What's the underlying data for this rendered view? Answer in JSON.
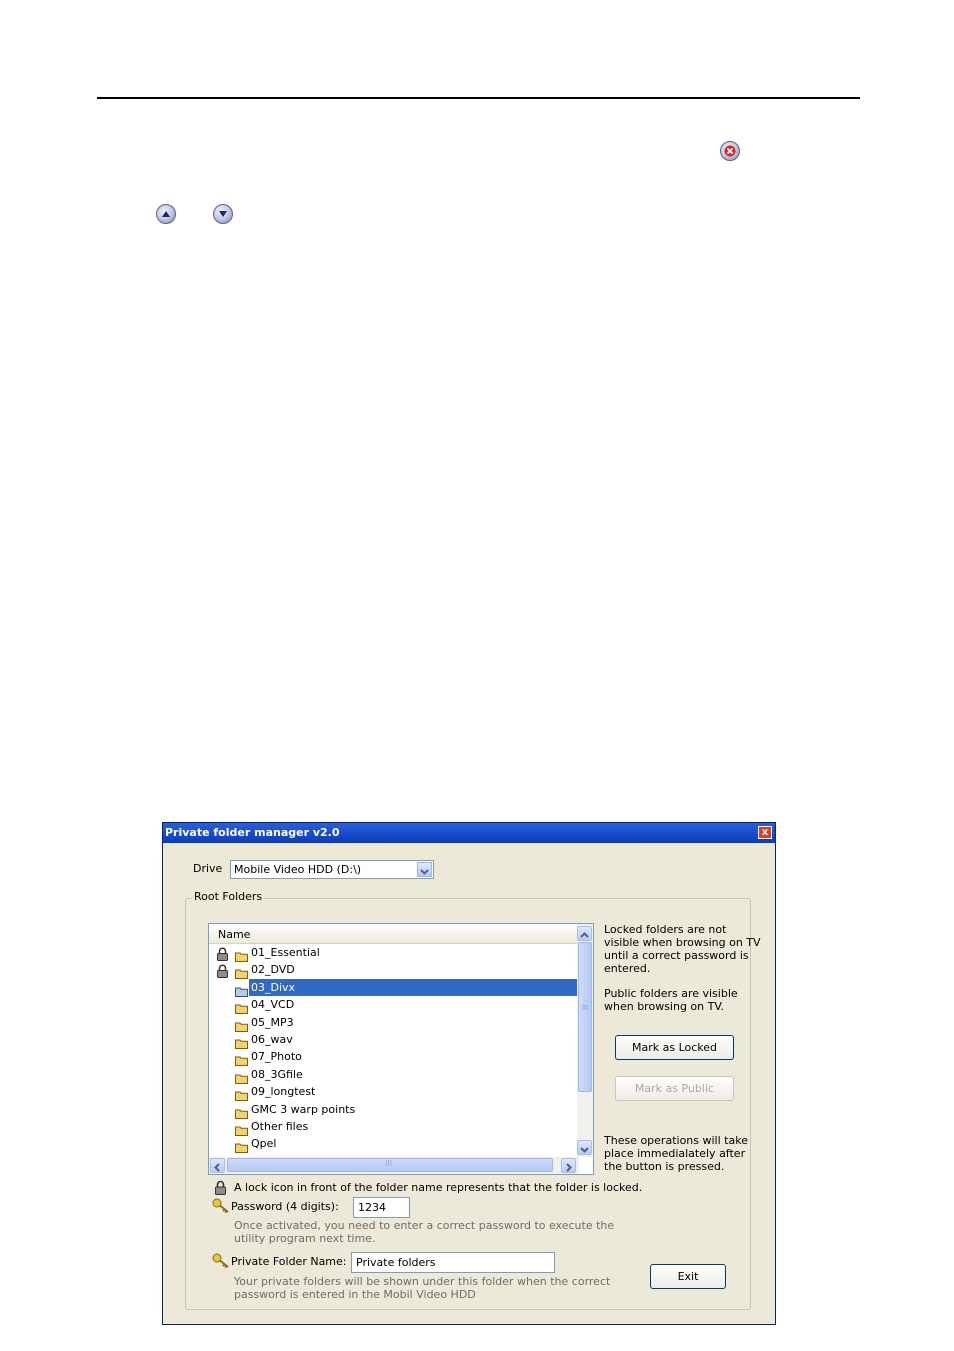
{
  "page": {
    "close_icon": "close-circle-icon",
    "up_icon": "up-arrow-circle-icon",
    "down_icon": "down-arrow-circle-icon"
  },
  "window": {
    "title": "Private folder manager v2.0",
    "close_label": "x",
    "drive_label": "Drive",
    "drive_value": "Mobile Video HDD (D:\\)",
    "group_title": "Root Folders",
    "list_header": "Name",
    "folders": [
      {
        "name": "01_Essential",
        "locked": true,
        "selected": false
      },
      {
        "name": "02_DVD",
        "locked": true,
        "selected": false
      },
      {
        "name": "03_Divx",
        "locked": false,
        "selected": true
      },
      {
        "name": "04_VCD",
        "locked": false,
        "selected": false
      },
      {
        "name": "05_MP3",
        "locked": false,
        "selected": false
      },
      {
        "name": "06_wav",
        "locked": false,
        "selected": false
      },
      {
        "name": "07_Photo",
        "locked": false,
        "selected": false
      },
      {
        "name": "08_3Gfile",
        "locked": false,
        "selected": false
      },
      {
        "name": "09_longtest",
        "locked": false,
        "selected": false
      },
      {
        "name": "GMC 3 warp points",
        "locked": false,
        "selected": false
      },
      {
        "name": "Other files",
        "locked": false,
        "selected": false
      },
      {
        "name": "Qpel",
        "locked": false,
        "selected": false
      }
    ],
    "info_locked_1": "Locked folders are not",
    "info_locked_2": "visible when browsing on TV",
    "info_locked_3": "until a correct password is",
    "info_locked_4": "entered.",
    "info_public_1": "Public folders are visible",
    "info_public_2": "when browsing on TV.",
    "mark_locked": "Mark as Locked",
    "mark_public": "Mark as Public",
    "info_ops_1": "These operations will take",
    "info_ops_2": "place immedialately after",
    "info_ops_3": "the button is pressed.",
    "lock_note": "A lock icon in front of the folder name represents that the folder is locked.",
    "password_label": "Password (4 digits):",
    "password_value": "1234",
    "password_note_1": "Once activated, you need to enter a correct password to execute the",
    "password_note_2": "utility program next time.",
    "private_name_label": "Private Folder Name:",
    "private_name_value": "Private folders",
    "private_note_1": "Your private folders will be shown under this folder when the correct",
    "private_note_2": "password is entered in the Mobil Video HDD",
    "exit_label": "Exit",
    "hscroll_grip": "III",
    "vscroll_grip": "≡"
  },
  "colors": {
    "titlebar": "#0a3cbf",
    "selection": "#316ac5",
    "window_bg": "#ece9d8"
  }
}
